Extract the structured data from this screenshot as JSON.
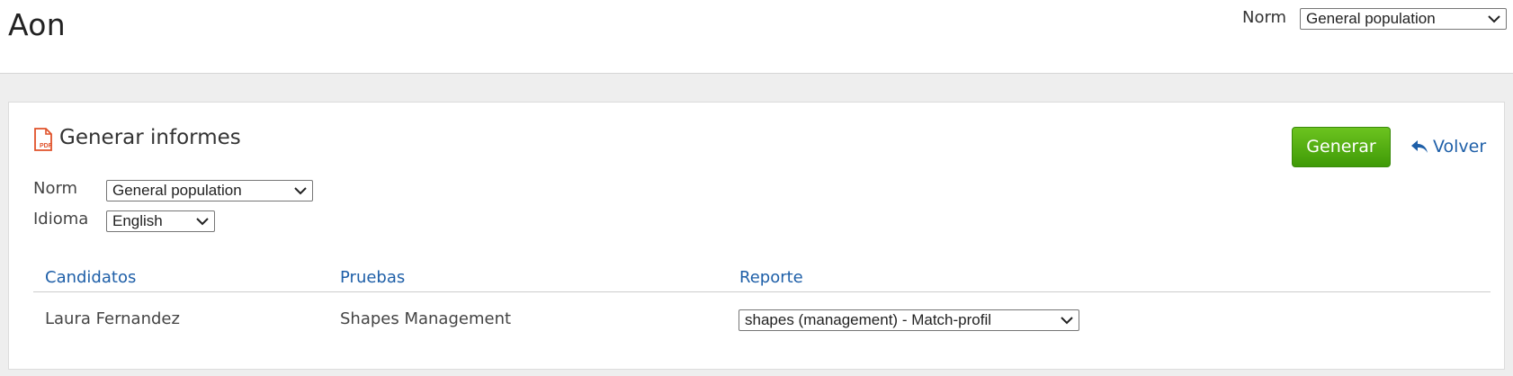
{
  "header": {
    "brand": "Aon",
    "norm_label": "Norm",
    "norm_value": "General population"
  },
  "panel": {
    "title": "Generar informes",
    "title_icon": "pdf-file-icon",
    "norm_label": "Norm",
    "norm_value": "General population",
    "idioma_label": "Idioma",
    "idioma_value": "English",
    "generate_button": "Generar",
    "back_link": "Volver",
    "back_icon": "reply-arrow-icon"
  },
  "table": {
    "columns": [
      "Candidatos",
      "Pruebas",
      "Reporte"
    ],
    "rows": [
      {
        "candidate": "Laura Fernandez",
        "test": "Shapes Management",
        "report": "shapes (management) - Match-profil"
      }
    ]
  },
  "colors": {
    "accent_link": "#1e5fa8",
    "button_green": "#4fa80f",
    "pdf_icon": "#e0522a"
  }
}
